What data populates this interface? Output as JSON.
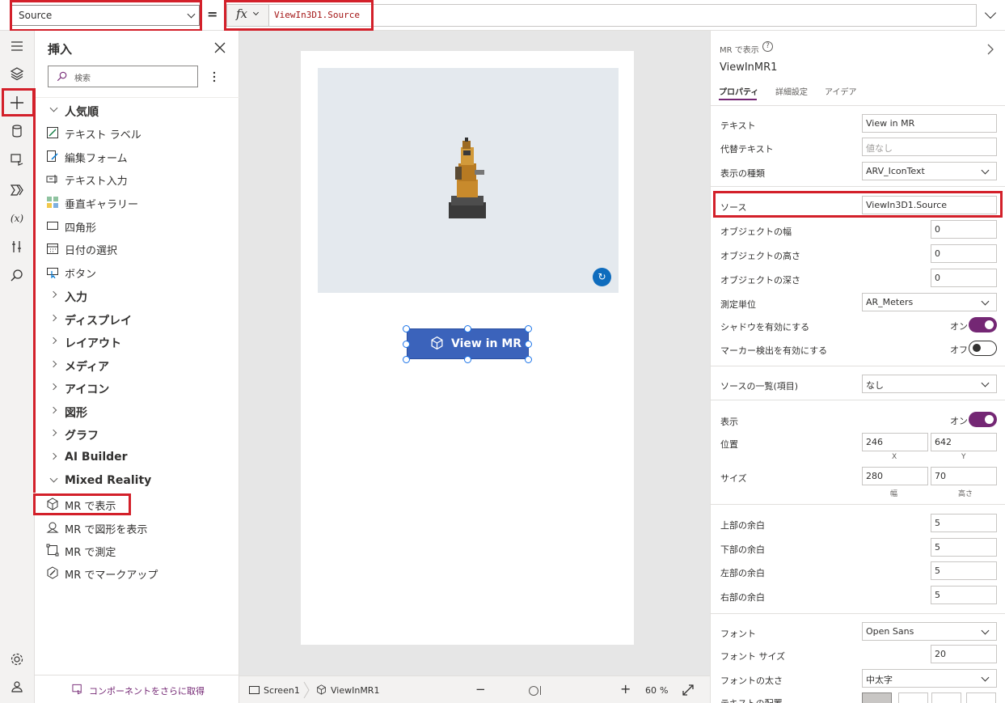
{
  "formula_bar": {
    "property": "Source",
    "equals": "=",
    "fx": "fx",
    "formula": "ViewIn3D1.Source"
  },
  "rail": {
    "icons": [
      "hamburger-icon",
      "layers-icon",
      "plus-icon",
      "database-icon",
      "media-icon",
      "power-automate-icon",
      "variables-icon",
      "tools-icon",
      "search-icon",
      "settings-icon",
      "account-icon"
    ],
    "variables_label": "(x)"
  },
  "insert": {
    "title": "挿入",
    "search_placeholder": "検索",
    "popular_header": "人気順",
    "popular_items": [
      {
        "label": "テキスト ラベル",
        "icon": "text-label-icon"
      },
      {
        "label": "編集フォーム",
        "icon": "edit-form-icon"
      },
      {
        "label": "テキスト入力",
        "icon": "text-input-icon"
      },
      {
        "label": "垂直ギャラリー",
        "icon": "vertical-gallery-icon"
      },
      {
        "label": "四角形",
        "icon": "rectangle-icon"
      },
      {
        "label": "日付の選択",
        "icon": "date-picker-icon"
      },
      {
        "label": "ボタン",
        "icon": "button-icon"
      }
    ],
    "categories": [
      "入力",
      "ディスプレイ",
      "レイアウト",
      "メディア",
      "アイコン",
      "図形",
      "グラフ",
      "AI Builder"
    ],
    "mr_header": "Mixed Reality",
    "mr_items": [
      {
        "label": "MR で表示",
        "icon": "view-in-mr-icon"
      },
      {
        "label": "MR で図形を表示",
        "icon": "view-shape-in-mr-icon"
      },
      {
        "label": "MR で測定",
        "icon": "measure-in-mr-icon"
      },
      {
        "label": "MR でマークアップ",
        "icon": "markup-in-mr-icon"
      }
    ],
    "get_more": "コンポーネントをさらに取得"
  },
  "canvas": {
    "button_label": "View in MR",
    "reset_glyph": "↻"
  },
  "bottom_bar": {
    "screen": "Screen1",
    "control": "ViewInMR1",
    "minus": "−",
    "plus": "+",
    "zoom": "60",
    "percent": "%"
  },
  "properties": {
    "type_label": "MR で表示",
    "control_name": "ViewInMR1",
    "tabs": [
      "プロパティ",
      "詳細設定",
      "アイデア"
    ],
    "rows": {
      "text": {
        "label": "テキスト",
        "value": "View in MR"
      },
      "alt_text": {
        "label": "代替テキスト",
        "placeholder": "値なし"
      },
      "display_type": {
        "label": "表示の種類",
        "value": "ARV_IconText"
      },
      "source": {
        "label": "ソース",
        "value": "ViewIn3D1.Source"
      },
      "obj_width": {
        "label": "オブジェクトの幅",
        "value": "0"
      },
      "obj_height": {
        "label": "オブジェクトの高さ",
        "value": "0"
      },
      "obj_depth": {
        "label": "オブジェクトの深さ",
        "value": "0"
      },
      "units": {
        "label": "測定単位",
        "value": "AR_Meters"
      },
      "shadow": {
        "label": "シャドウを有効にする",
        "state": "オン"
      },
      "marker": {
        "label": "マーカー検出を有効にする",
        "state": "オフ"
      },
      "source_list": {
        "label": "ソースの一覧(項目)",
        "value": "なし"
      },
      "visible": {
        "label": "表示",
        "state": "オン"
      },
      "position": {
        "label": "位置",
        "x": "246",
        "y": "642",
        "x_lbl": "X",
        "y_lbl": "Y"
      },
      "size": {
        "label": "サイズ",
        "w": "280",
        "h": "70",
        "w_lbl": "幅",
        "h_lbl": "高さ"
      },
      "pad_top": {
        "label": "上部の余白",
        "value": "5"
      },
      "pad_bottom": {
        "label": "下部の余白",
        "value": "5"
      },
      "pad_left": {
        "label": "左部の余白",
        "value": "5"
      },
      "pad_right": {
        "label": "右部の余白",
        "value": "5"
      },
      "font": {
        "label": "フォント",
        "value": "Open Sans"
      },
      "font_size": {
        "label": "フォント サイズ",
        "value": "20"
      },
      "font_weight": {
        "label": "フォントの太さ",
        "value": "中太字"
      },
      "text_align": {
        "label": "テキストの配置"
      }
    }
  },
  "colors": {
    "accent": "#742774",
    "highlight": "#d3202a",
    "button": "#3b63bb"
  }
}
